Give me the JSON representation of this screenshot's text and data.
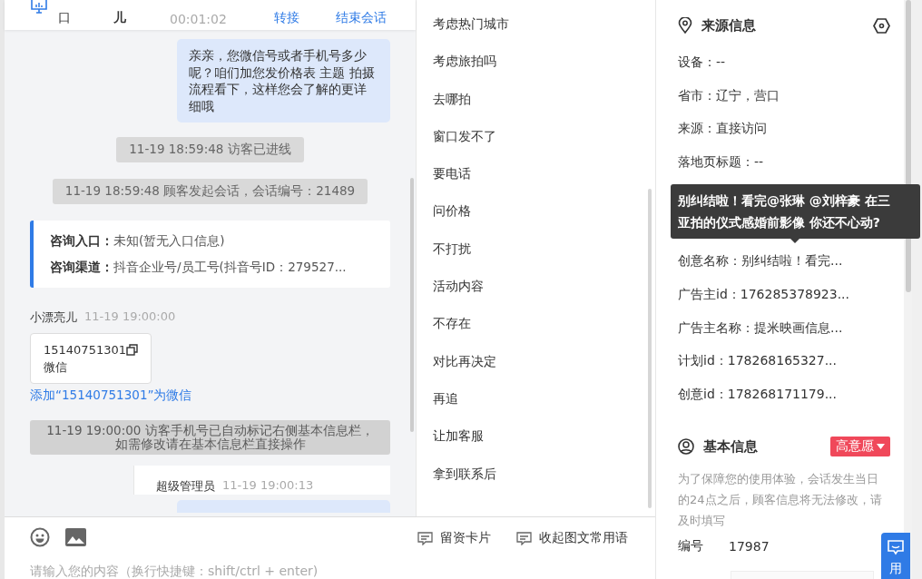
{
  "header": {
    "entry": "口",
    "visitor": "儿",
    "duration": "00:01:02",
    "actions": [
      "转接",
      "结束会话"
    ]
  },
  "messages": [
    {
      "kind": "agent_text",
      "text": "亲亲，您微信号或者手机号多少呢？咱们加您发价格表 主题 拍摄流程看下，这样您会了解的更详细哦"
    },
    {
      "kind": "system",
      "text": "11-19 18:59:48 访客已进线"
    },
    {
      "kind": "system",
      "text": "11-19 18:59:48 顾客发起会话，会话编号：21489"
    },
    {
      "kind": "info",
      "rows": [
        {
          "label": "咨询入口：",
          "value": "未知(暂无入口信息)"
        },
        {
          "label": "咨询渠道：",
          "value": "抖音企业号/员工号(抖音号ID：279527..."
        }
      ]
    },
    {
      "kind": "visitor_meta",
      "name": "小漂亮儿",
      "time": "11-19 19:00:00"
    },
    {
      "kind": "contact_card",
      "number": "15140751301",
      "type": "微信"
    },
    {
      "kind": "link",
      "text": "添加“15140751301”为微信"
    },
    {
      "kind": "system_block",
      "lines": [
        "11-19 19:00:00 访客手机号已自动标记右侧基本信息栏，",
        "如需修改请在基本信息栏直接操作"
      ]
    },
    {
      "kind": "agent_meta",
      "name": "超级管理员",
      "time": "11-19 19:00:13"
    },
    {
      "kind": "agent_cut"
    }
  ],
  "quick_replies": [
    "考虑热门城市",
    "考虑旅拍吗",
    "去哪拍",
    "窗口发不了",
    "要电话",
    "问价格",
    "不打扰",
    "活动内容",
    "不存在",
    "对比再决定",
    "再追",
    "让加客服",
    "拿到联系后"
  ],
  "toolbar": {
    "buttons": [
      "留资卡片",
      "收起图文常用语"
    ],
    "placeholder": "请输入您的内容（换行快捷键：shift/ctrl + enter)"
  },
  "source_info": {
    "title": "来源信息",
    "rows_top": [
      "设备：--",
      "省市：辽宁，营口",
      "来源：直接访问",
      "落地页标题：--"
    ],
    "tooltip": [
      "别纠结啦！看完@张琳 @刘梓豪 在三",
      "亚拍的仪式感婚前影像 你还不心动?"
    ],
    "rows_bottom": [
      "创意名称：别纠结啦！看完...",
      "广告主id：176285378923...",
      "广告主名称：提米映画信息...",
      "计划id：178268165327...",
      "创意id：178268171179..."
    ]
  },
  "basic_info": {
    "title": "基本信息",
    "intent": "高意愿",
    "notice": "为了保障您的使用体验，会话发生当日的24点之后，顾客信息将无法修改，请及时填写",
    "fields": [
      {
        "label": "编号",
        "value": "17987"
      }
    ]
  },
  "float_button": "用"
}
